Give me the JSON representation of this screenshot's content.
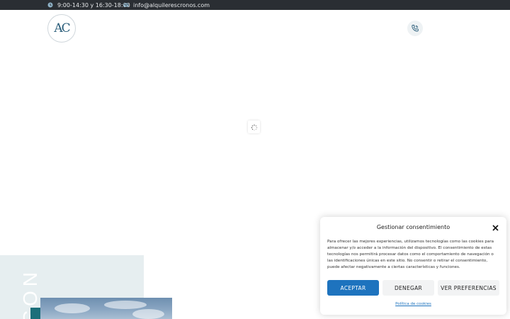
{
  "topbar": {
    "hours": "9:00-14:30 y 16:30-18:00",
    "email": "info@alquilerescronos.com",
    "hours_icon": "clock-icon",
    "email_icon": "mail-icon"
  },
  "header": {
    "logo_text": "AC",
    "phone_icon": "phone-icon"
  },
  "hero": {
    "vertical_text": "NOS"
  },
  "consent": {
    "title": "Gestionar consentimiento",
    "body": "Para ofrecer las mejores experiencias, utilizamos tecnologías como las cookies para almacenar y/o acceder a la información del dispositivo. El consentimiento de estas tecnologías nos permitirá procesar datos como el comportamiento de navegación o las identificaciones únicas en este sitio. No consentir o retirar el consentimiento, puede afectar negativamente a ciertas características y funciones.",
    "accept_label": "ACEPTAR",
    "deny_label": "DENEGAR",
    "prefs_label": "VER PREFERENCIAS",
    "policy_link": "Política de cookies",
    "close_icon": "close-icon"
  },
  "colors": {
    "topbar_bg": "#2a2e33",
    "accent": "#1e73be",
    "hero_bg": "#e6eef0",
    "teal": "#1c6f7a"
  }
}
